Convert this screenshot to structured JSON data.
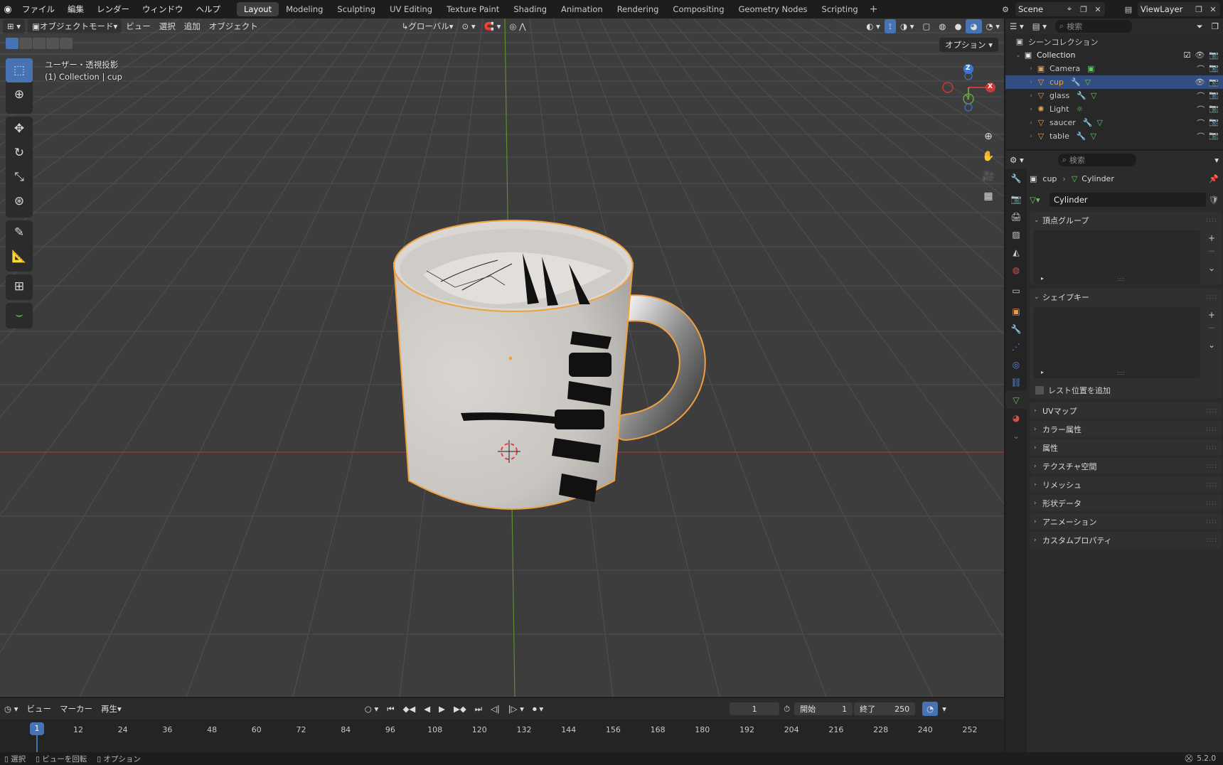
{
  "app": {
    "menu": [
      "ファイル",
      "編集",
      "レンダー",
      "ウィンドウ",
      "ヘルプ"
    ],
    "workspaces": [
      "Layout",
      "Modeling",
      "Sculpting",
      "UV Editing",
      "Texture Paint",
      "Shading",
      "Animation",
      "Rendering",
      "Compositing",
      "Geometry Nodes",
      "Scripting"
    ],
    "active_workspace": "Layout",
    "scene": "Scene",
    "view_layer": "ViewLayer"
  },
  "viewport": {
    "mode": "オブジェクトモード",
    "menus": [
      "ビュー",
      "選択",
      "追加",
      "オブジェクト"
    ],
    "transform_orientation": "グローバル",
    "options_label": "オプション",
    "overlay_line1": "ユーザー・透視投影",
    "overlay_line2": "(1) Collection | cup",
    "gizmo": {
      "x": "X",
      "y": "Y",
      "z": "Z"
    },
    "mug_text": "DYNAM"
  },
  "timeline": {
    "menus": [
      "ビュー",
      "マーカー",
      "再生"
    ],
    "current_frame": "1",
    "start_label": "開始",
    "start": "1",
    "end_label": "終了",
    "end": "250",
    "ruler": [
      "12",
      "24",
      "36",
      "48",
      "60",
      "72",
      "84",
      "96",
      "108",
      "120",
      "132",
      "144",
      "156",
      "168",
      "180",
      "192",
      "204",
      "216",
      "228",
      "240",
      "252"
    ]
  },
  "status": {
    "items": [
      "選択",
      "ビューを回転",
      "オプション"
    ],
    "version": "5.2.0"
  },
  "outliner": {
    "search_placeholder": "検索",
    "scene_collection": "シーンコレクション",
    "collection": "Collection",
    "objects": [
      {
        "name": "Camera",
        "icon": "camera-icon",
        "color": "#e0a060"
      },
      {
        "name": "cup",
        "icon": "mesh-icon",
        "color": "#e89a50",
        "selected": true
      },
      {
        "name": "glass",
        "icon": "mesh-icon",
        "color": "#e89a50"
      },
      {
        "name": "Light",
        "icon": "light-icon",
        "color": "#e0a060"
      },
      {
        "name": "saucer",
        "icon": "mesh-icon",
        "color": "#e89a50"
      },
      {
        "name": "table",
        "icon": "mesh-icon",
        "color": "#e89a50"
      }
    ]
  },
  "properties": {
    "search_placeholder": "検索",
    "breadcrumb_object": "cup",
    "breadcrumb_data": "Cylinder",
    "mesh_name": "Cylinder",
    "vertex_groups": "頂点グループ",
    "shape_keys": "シェイプキー",
    "relative_checkbox": "レスト位置を追加",
    "closed_panels": [
      "UVマップ",
      "カラー属性",
      "属性",
      "テクスチャ空間",
      "リメッシュ",
      "形状データ",
      "アニメーション",
      "カスタムプロパティ"
    ]
  },
  "colors": {
    "accent": "#4772b3",
    "selection_outline": "#f0a040",
    "x_axis": "#c8383f",
    "y_axis": "#6aa03a"
  }
}
